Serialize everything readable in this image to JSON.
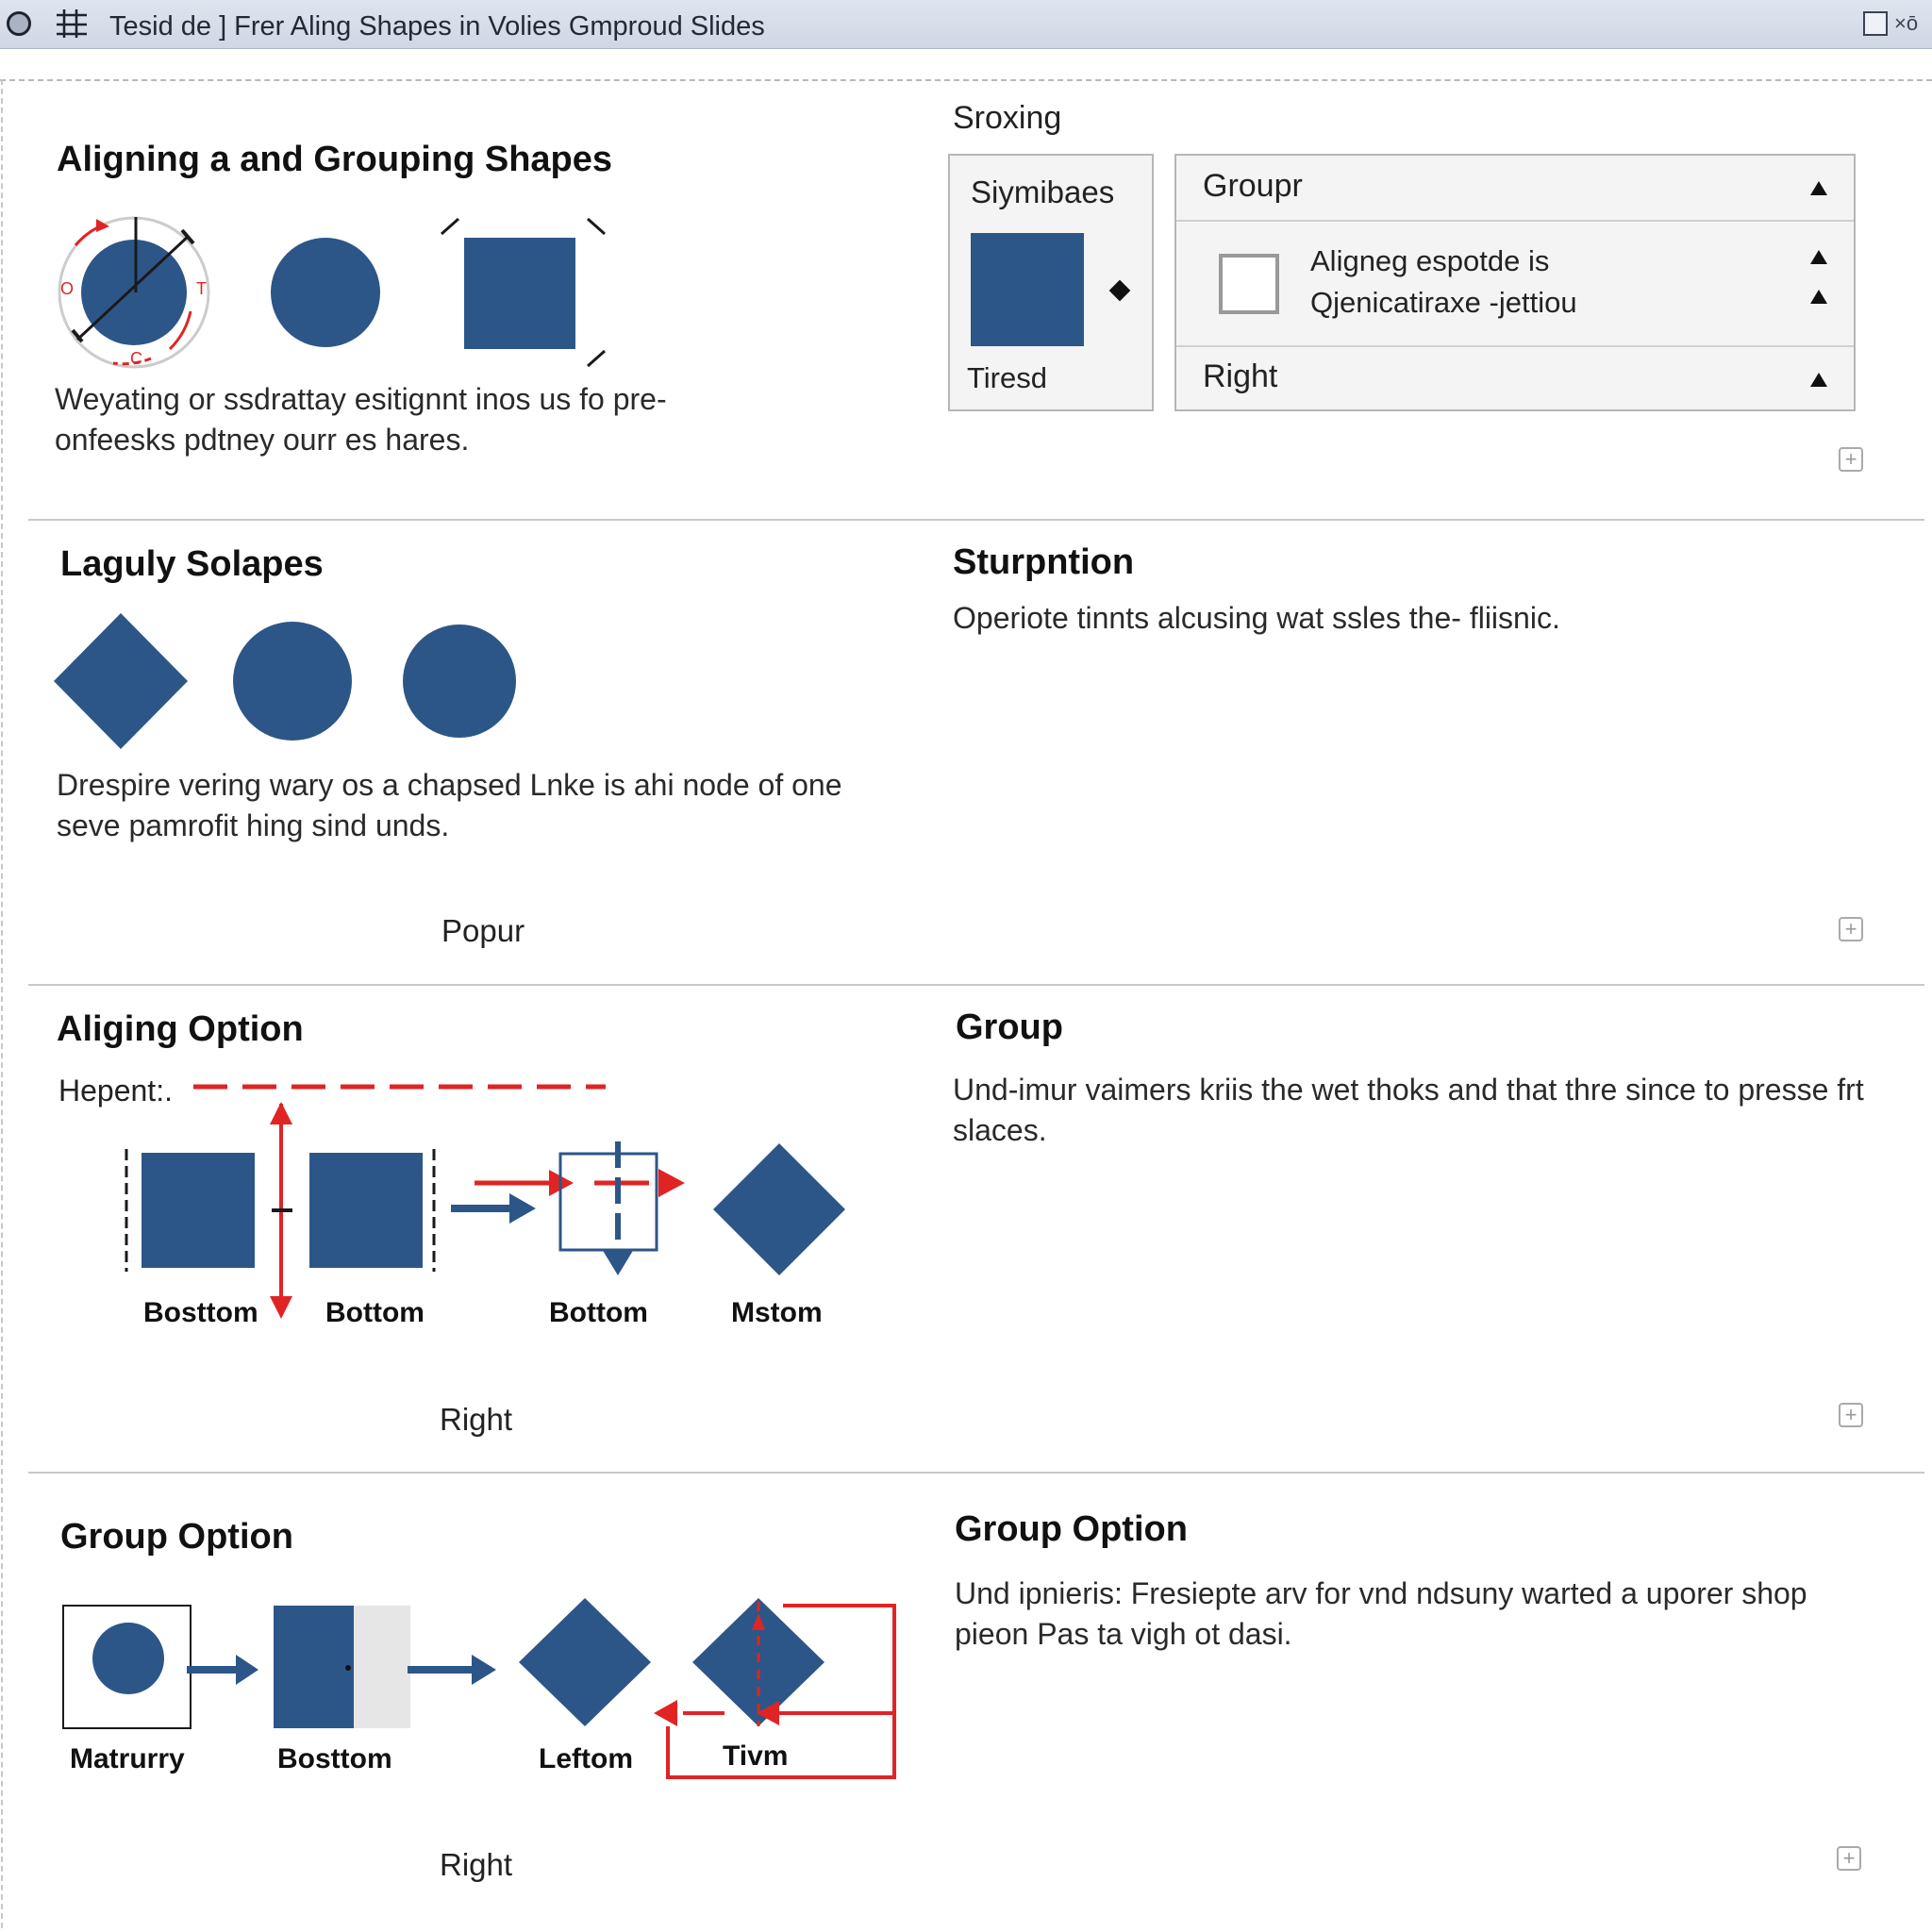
{
  "window": {
    "title": "Tesid de ] Frer Aling Shapes in Volies Gmproud Slides",
    "close_label": "×ō"
  },
  "section1": {
    "heading": "Aligning a and Grouping Shapes",
    "description": "Weyating or ssdrattay esitignnt inos us fo pre- onfeesks pdtney ourr es hares."
  },
  "panel": {
    "label": "Sroxing",
    "symbols": {
      "title": "Siymibaes",
      "footer": "Tiresd"
    },
    "group": {
      "header": "Groupr",
      "checkbox_text_1": "Aligneg espotde is",
      "checkbox_text_2": "Qjenicatiraxe -jettiou",
      "right_label": "Right"
    }
  },
  "section2": {
    "heading": "Laguly Solapes",
    "description": "Drespire vering wary os a chapsed Lnke is ahi node of one seve pamrofit hing sind unds.",
    "caption": "Popur",
    "side_heading": "Sturpntion",
    "side_text": "Operiote tinnts alcusing wat ssles the- fliisnic."
  },
  "section3": {
    "heading": "Aliging Option",
    "hepent_label": "Hepent:.",
    "shape_labels": [
      "Bosttom",
      "Bottom",
      "Bottom",
      "Mstom"
    ],
    "caption": "Right",
    "side_heading": "Group",
    "side_text": "Und-imur vaimers kriis the wet thoks and that thre since to presse frt slaces."
  },
  "section4": {
    "heading": "Group Option",
    "shape_labels": [
      "Matrurry",
      "Bosttom",
      "Leftom",
      "Tivm"
    ],
    "caption": "Right",
    "side_heading": "Group Option",
    "side_text": "Und ipnieris: Fresiepte arv for vnd ndsuny warted a uporer shop pieon Pas ta vigh ot dasi."
  },
  "colors": {
    "shape_blue": "#2d5688",
    "accent_red": "#e02424",
    "divider_gray": "#c8c8c8",
    "titlebar": "#d6dde8"
  },
  "icons": [
    "circle-icon",
    "grid-icon",
    "maximize-icon",
    "close-icon",
    "expand-plus-icon",
    "triangle-up-icon",
    "arrow-right-icon"
  ]
}
